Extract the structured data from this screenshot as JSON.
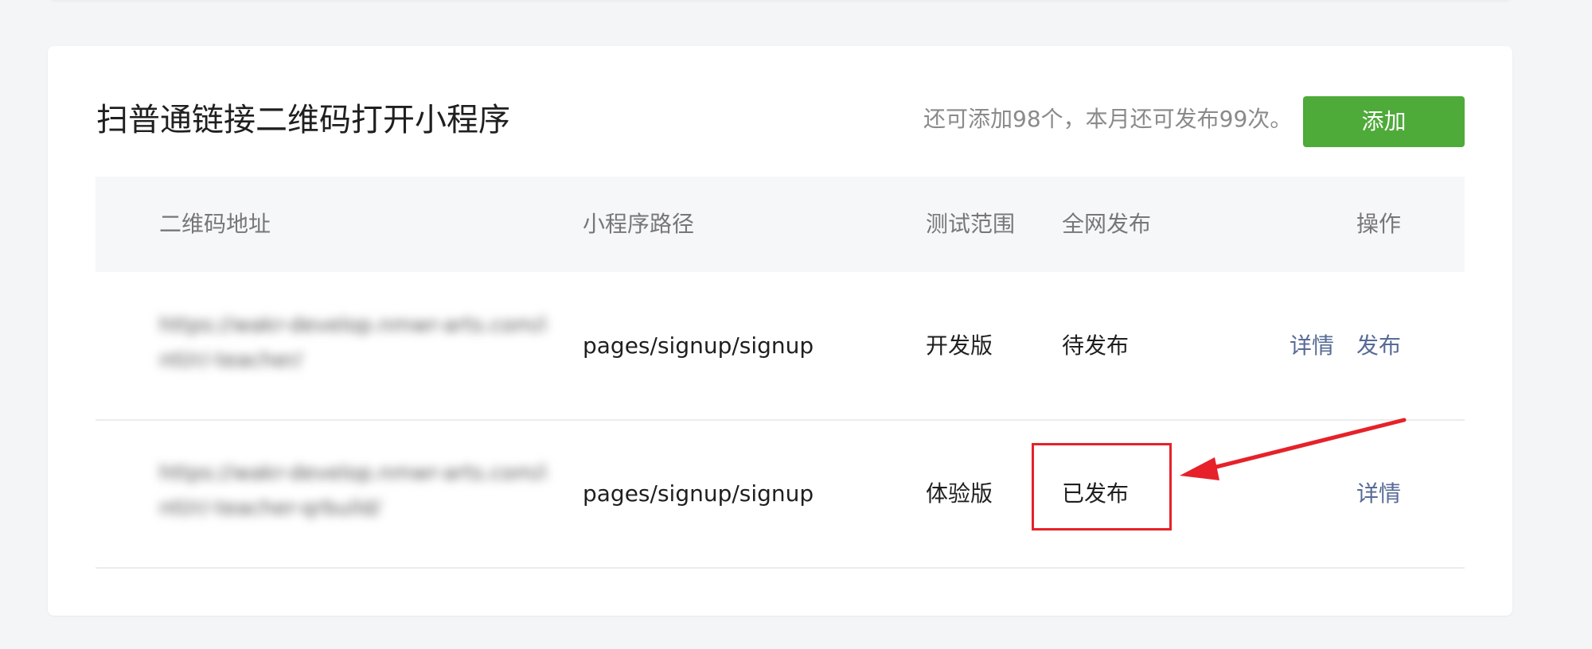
{
  "section": {
    "title": "扫普通链接二维码打开小程序",
    "quota_text": "还可添加98个，本月还可发布99次。",
    "add_label": "添加"
  },
  "table": {
    "headers": [
      "二维码地址",
      "小程序路径",
      "测试范围",
      "全网发布",
      "操作"
    ],
    "rows": [
      {
        "qr_url": "https://wakr-develop.nmwr-arts.com/intl/r/-teacher/",
        "path": "pages/signup/signup",
        "scope": "开发版",
        "status": "待发布",
        "actions": [
          "详情",
          "发布"
        ]
      },
      {
        "qr_url": "https://wakr-develop.nmwr-arts.com/intl/r/-teacher-qrbuild/",
        "path": "pages/signup/signup",
        "scope": "体验版",
        "status": "已发布",
        "actions": [
          "详情"
        ]
      }
    ]
  },
  "colors": {
    "primary_button": "#4eaa39",
    "link": "#576b95",
    "annotation": "#e6212a"
  }
}
